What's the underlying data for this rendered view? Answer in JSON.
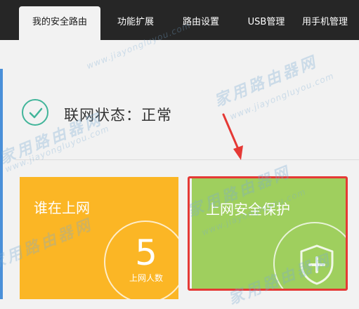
{
  "nav": {
    "tabs": [
      {
        "label": "我的安全路由",
        "active": true
      },
      {
        "label": "功能扩展",
        "active": false
      },
      {
        "label": "路由设置",
        "active": false
      },
      {
        "label": "USB管理",
        "active": false
      },
      {
        "label": "用手机管理",
        "active": false
      }
    ]
  },
  "status": {
    "text": "联网状态：正常",
    "icon": "check-circle-icon"
  },
  "cards": {
    "online": {
      "title": "谁在上网",
      "count": "5",
      "count_label": "上网人数"
    },
    "protect": {
      "title": "上网安全保护",
      "icon": "shield-plus-icon"
    }
  },
  "watermark": {
    "cn": "家用路由器网",
    "en": "www.jiayongluyou.com"
  },
  "colors": {
    "topbar": "#262626",
    "online_card": "#fbb625",
    "protect_card": "#9fcf5e",
    "status_icon": "#42b59a",
    "highlight": "#e53935"
  }
}
